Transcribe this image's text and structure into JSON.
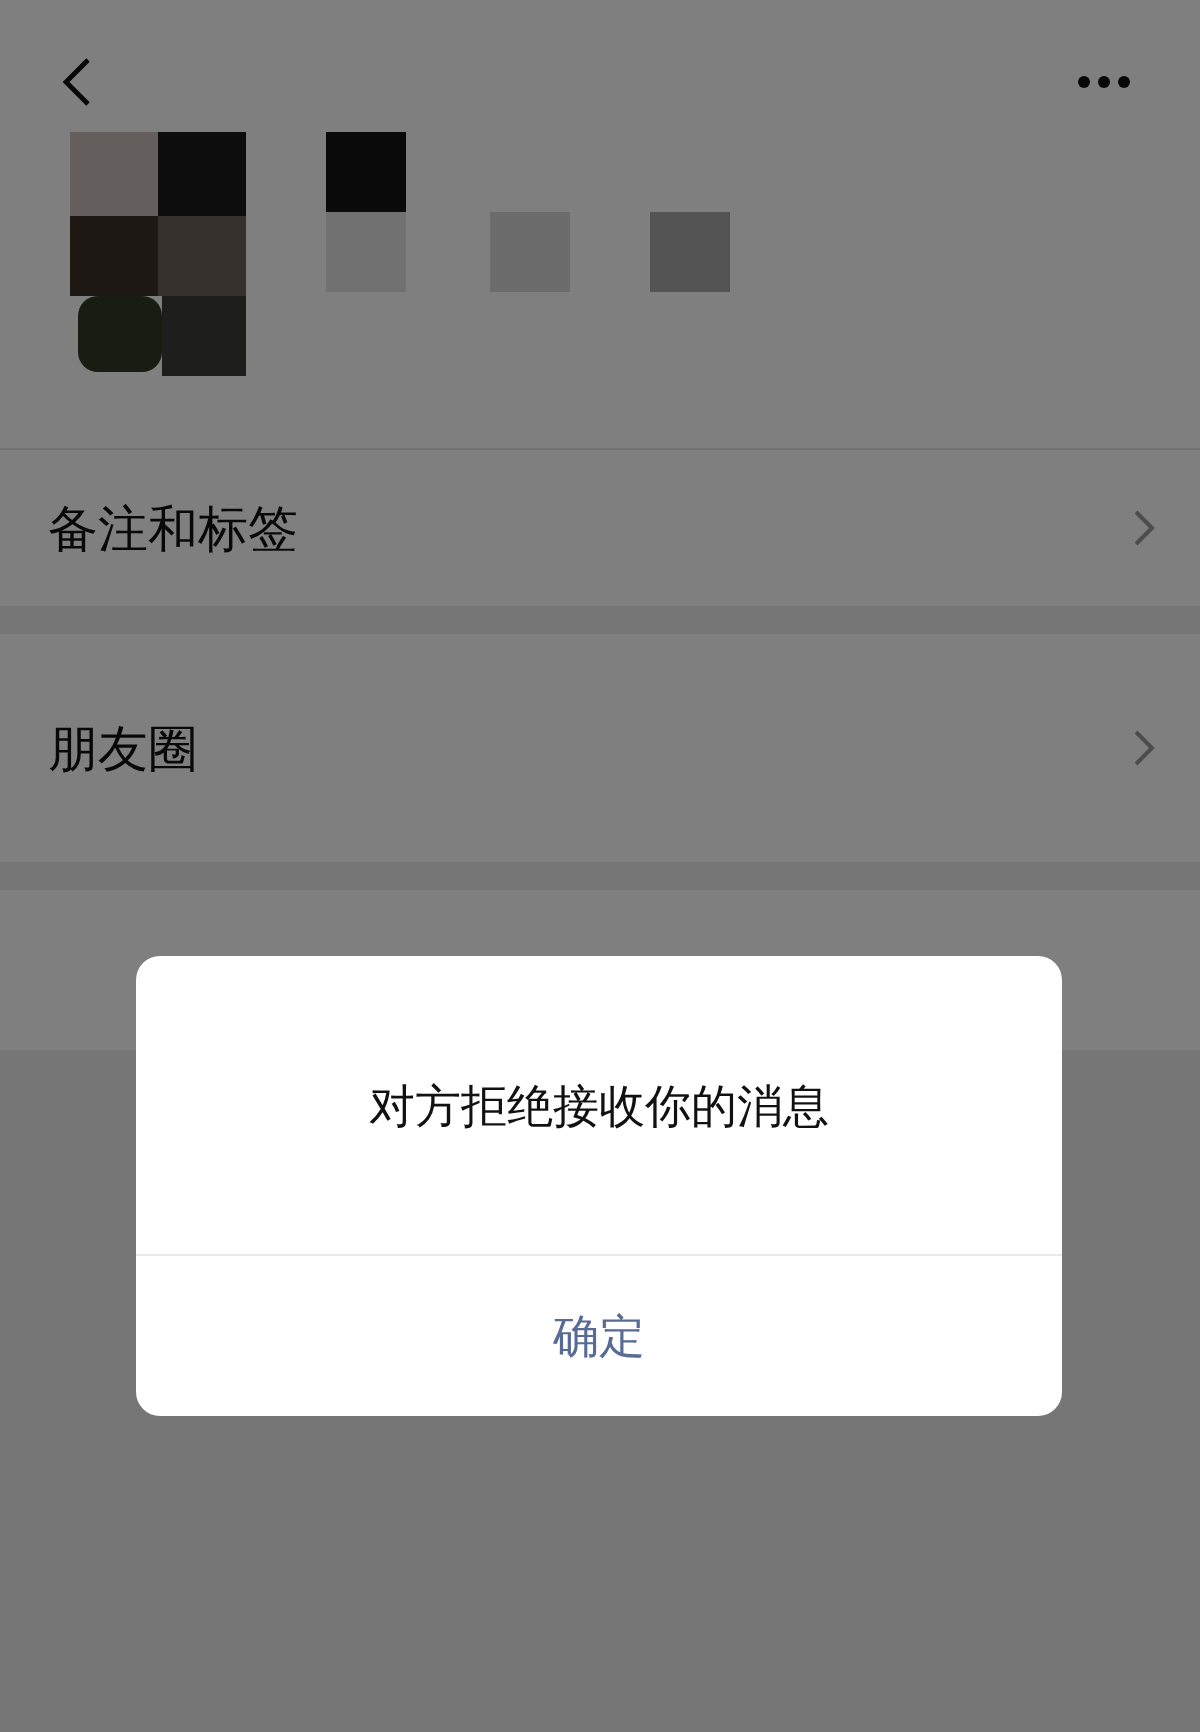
{
  "rows": [
    {
      "label": "备注和标签"
    },
    {
      "label": "朋友圈"
    }
  ],
  "dialog": {
    "message": "对方拒绝接收你的消息",
    "button": "确定"
  }
}
